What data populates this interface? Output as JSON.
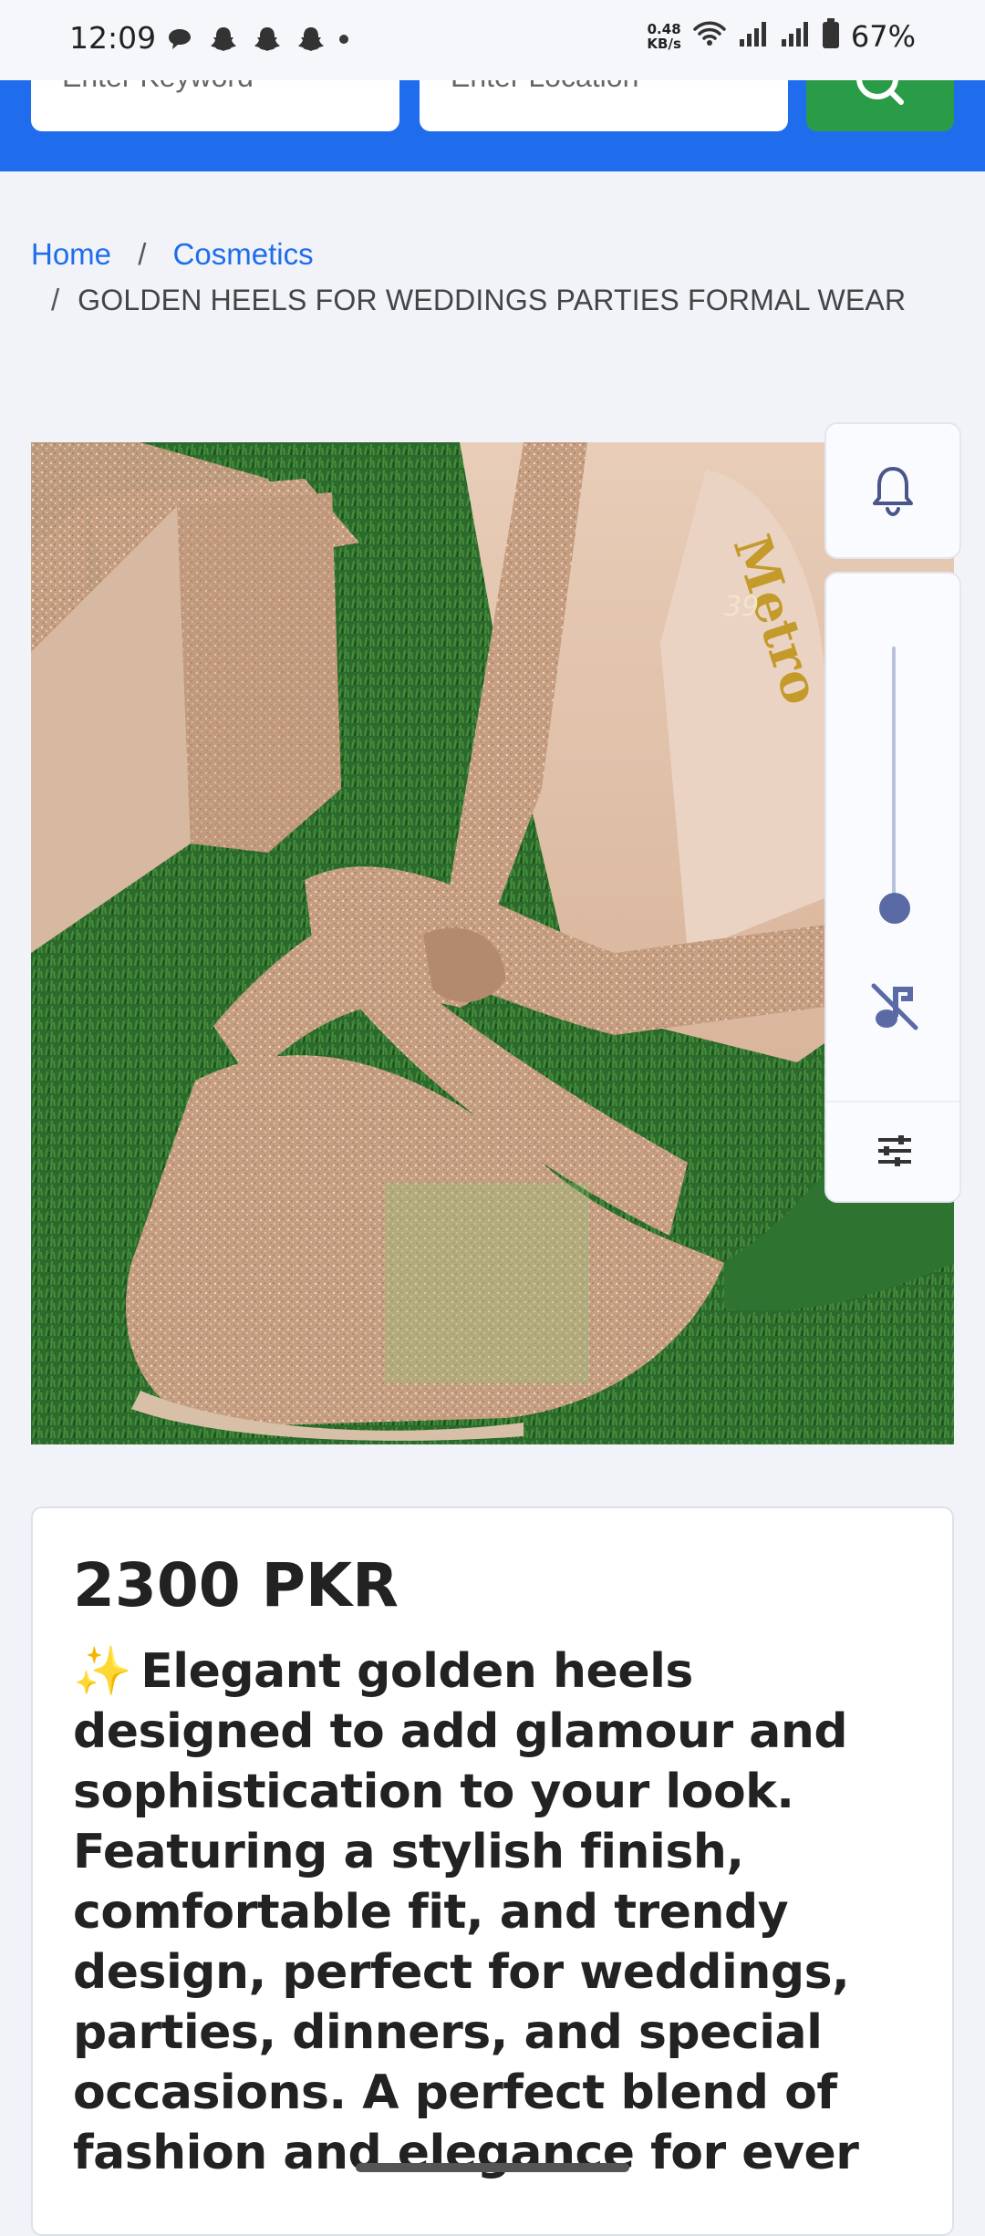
{
  "status_bar": {
    "time": "12:09",
    "net_speed_value": "0.48",
    "net_speed_unit": "KB/s",
    "battery": "67%"
  },
  "header": {
    "keyword_placeholder": "Enter Keyword",
    "location_placeholder": "Enter Location",
    "search_icon": "search-icon",
    "colors": {
      "header_bg": "#1f6ded",
      "search_button": "#2a9c48"
    }
  },
  "breadcrumb": {
    "home": "Home",
    "category": "Cosmetics",
    "current": "GOLDEN HEELS FOR WEDDINGS PARTIES FORMAL WEAR"
  },
  "controls": {
    "bell_icon": "bell-icon",
    "volume_level": 0.1,
    "mute_icon": "music-off-icon",
    "settings_icon": "sliders-icon"
  },
  "product": {
    "price": "2300 PKR",
    "description_emoji": "✨",
    "description": "Elegant golden heels designed to add glamour and sophistication to your look. Featuring a stylish finish, comfortable fit, and trendy design, perfect for weddings, parties, dinners, and special occasions. A perfect blend of fashion and elegance for ever"
  }
}
